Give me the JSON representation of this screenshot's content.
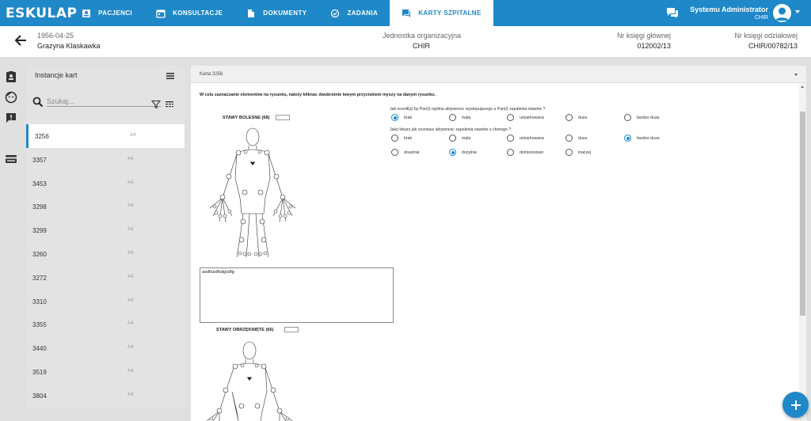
{
  "app": {
    "logo_text": "ESKULAP"
  },
  "nav": {
    "items": [
      {
        "label": "PACJENCI",
        "icon": "contact-card-icon"
      },
      {
        "label": "KONSULTACJE",
        "icon": "calendar-icon"
      },
      {
        "label": "DOKUMENTY",
        "icon": "document-icon"
      },
      {
        "label": "ZADANIA",
        "icon": "tasks-icon"
      },
      {
        "label": "KARTY SZPITALNE",
        "icon": "cards-icon",
        "active": true
      }
    ]
  },
  "user": {
    "name": "Systemu Administrator",
    "unit": "CHIR"
  },
  "patient": {
    "dob": "1956-04-25",
    "name": "Grazyna Klaskawka",
    "org_label": "Jednostka organizacyjna",
    "org_value": "CHIR",
    "main_book_label": "Nr księgi głównej",
    "main_book_value": "012002/13",
    "dept_book_label": "Nr księgi odziałowej",
    "dept_book_value": "CHIR/00782/13"
  },
  "instances": {
    "title": "Instancje kart",
    "search_placeholder": "Szukaj...",
    "rows": [
      {
        "id": "3256",
        "format": "A4"
      },
      {
        "id": "3357",
        "format": "A4"
      },
      {
        "id": "3453",
        "format": "A4"
      },
      {
        "id": "3298",
        "format": "A4"
      },
      {
        "id": "3299",
        "format": "A4"
      },
      {
        "id": "3260",
        "format": "A4"
      },
      {
        "id": "3272",
        "format": "A4"
      },
      {
        "id": "3310",
        "format": "A4"
      },
      {
        "id": "3355",
        "format": "A4"
      },
      {
        "id": "3440",
        "format": "A4"
      },
      {
        "id": "3519",
        "format": "A4"
      },
      {
        "id": "3804",
        "format": "A4"
      }
    ],
    "active_index": 0
  },
  "card": {
    "title": "Karta 3256",
    "instruction": "W celu zaznaczanie elementów na rysunku, należy kliknac dwukrotnie lewym przyciskiem myszy na danym rysunku.",
    "figure1_label": "STAWY BOLESNE (68)",
    "figure2_label": "STAWY OBRZĘKNIĘTE (66)",
    "q1": "Jak ocenił(a) by Pan(i) ogólna aktywnosc wystepujacego u Pan(i) zapalenia stawów ?",
    "q1_options": [
      "brak",
      "mala",
      "umiarkowana",
      "duza",
      "bardzo duza"
    ],
    "q1_selected": 0,
    "q2": "Jako lekarz jak oceniasz aktywnosc zapalenia stawów u chorego ?",
    "q2_options": [
      "brak",
      "mala",
      "umiarkowana",
      "duza",
      "bardzo duza"
    ],
    "q2_selected": 4,
    "q3_options": [
      "doustnie",
      "dożylnie",
      "domieśniowo",
      "inaczej"
    ],
    "q3_selected": 1,
    "notes": "asdfsadfsdgsdfg"
  },
  "colors": {
    "brand": "#1e88c9"
  }
}
